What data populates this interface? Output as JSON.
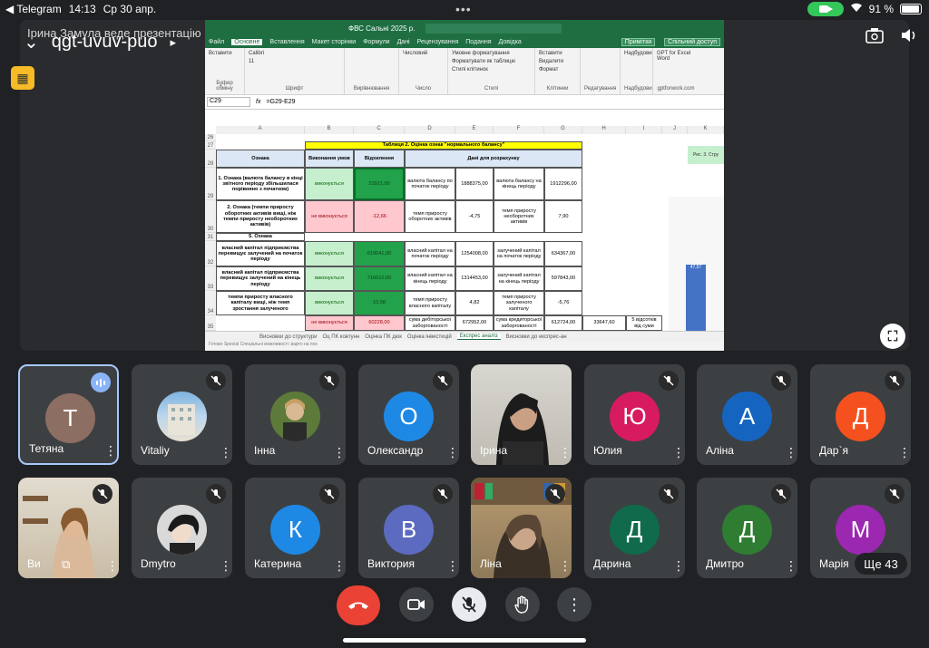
{
  "status_bar": {
    "back_app": "◀ Telegram",
    "time": "14:13",
    "date": "Ср 30 апр.",
    "battery": "91 %"
  },
  "meeting": {
    "code": "qgt-uvuv-puo",
    "overlay_text": "Ірина Замула веде презентацію"
  },
  "excel": {
    "title": "ФВС Сальні 2025 р.",
    "menu": [
      "Файл",
      "Основне",
      "Вставлення",
      "Макет сторінки",
      "Формули",
      "Дані",
      "Рецензування",
      "Подання",
      "Довідка"
    ],
    "menu_right": [
      "Примітки",
      "Спільний доступ"
    ],
    "ribbon_groups": [
      {
        "label": "Буфер обміну",
        "items": [
          "Вставити"
        ]
      },
      {
        "label": "Шрифт",
        "items": [
          "Calibri",
          "11"
        ]
      },
      {
        "label": "Вирівнювання",
        "items": [
          ""
        ]
      },
      {
        "label": "Число",
        "items": [
          "Числовий"
        ]
      },
      {
        "label": "Стилі",
        "items": [
          "Умовне форматування",
          "Форматувати як таблицю",
          "Стилі клітинок"
        ]
      },
      {
        "label": "Клітинки",
        "items": [
          "Вставити",
          "Видалити",
          "Формат"
        ]
      },
      {
        "label": "Редагування",
        "items": [
          ""
        ]
      },
      {
        "label": "Надбудови",
        "items": [
          "Надбудови"
        ]
      },
      {
        "label": "gptforwork.com",
        "items": [
          "GPT for Excel Word"
        ]
      }
    ],
    "namebox": "C29",
    "formula": "=G29-E29",
    "columns": [
      "A",
      "B",
      "C",
      "D",
      "E",
      "F",
      "G",
      "H",
      "I",
      "J",
      "K"
    ],
    "rows": [
      "26",
      "27",
      "28",
      "29",
      "30",
      "31",
      "32",
      "33",
      "34",
      "35"
    ],
    "table_title": "Таблиця 2. Оцінка ознак \"нормального балансу\"",
    "headers": {
      "a": "Ознака",
      "b": "Виконання умов",
      "c": "Відхилення",
      "d": "Дані для розрахунку"
    },
    "r29": {
      "a": "1. Ознака (валюта балансу в кінці звітного періоду збільшилася порівняно з початком)",
      "b": "виконується",
      "c": "23921,00",
      "d": "валюта балансу по початок періоду",
      "e": "1888375,00",
      "f": "валюта балансу на кінець періоду",
      "g": "1912296,00"
    },
    "r30": {
      "a": "2. Ознака (темпи приросту оборотних активів вищі, ніж темпи приросту необоротних активів)",
      "b": "не виконується",
      "c": "-12,66",
      "d": "темп приросту оборотних активів",
      "e": "-4,75",
      "f": "темп приросту необоротних активів",
      "g": "7,90"
    },
    "r31": {
      "a": "5. Ознака"
    },
    "r32": {
      "a": "власний капітал підприємства перевищує залучений на початок періоду",
      "b": "виконується",
      "c": "619641,00",
      "d": "власний капітал на початок періоду",
      "e": "1254008,00",
      "f": "залучений капітал на початок періоду",
      "g": "634367,00"
    },
    "r33": {
      "a": "власний капітал підприємства перевищує залучений на кінець періоду",
      "b": "виконується",
      "c": "716610,00",
      "d": "власний капітал на кінець періоду",
      "e": "1314453,00",
      "f": "залучений капітал на кінець періоду",
      "g": "597843,00"
    },
    "r34": {
      "a": "темпи приросту власного капіталу вищі, ніж темп зростання залученого",
      "b": "виконується",
      "c": "10,58",
      "d": "темп приросту власного капіталу",
      "e": "4,82",
      "f": "темп приросту залученого капіталу",
      "g": "-5,76"
    },
    "r35": {
      "b": "не виконується",
      "c": "60228,00",
      "d": "сума дебіторської заборгованості",
      "e": "672952,00",
      "f": "сума кредиторської заборгованості",
      "g": "612724,00",
      "h": "33647,60",
      "i": "5 відсотків від суми"
    },
    "side_label": "Рис. 3. Стру",
    "side_bar_value": "47,57",
    "sheet_tabs": [
      "Висновки до структури",
      "Оц ПК ковтунн",
      "Оцінка ПК дюк",
      "Оцінка інвестицій",
      "Експрес аналіз",
      "Висновки до експрес-ан"
    ],
    "status": "Готово   Special   Спеціальні можливості: варто на пох"
  },
  "participants": [
    {
      "name": "Тетяна",
      "initial": "Т",
      "color": "#8d6e63",
      "speaking": true
    },
    {
      "name": "Vitaliy",
      "initial": "",
      "color": "#6d8fb5",
      "photo": true
    },
    {
      "name": "Інна",
      "initial": "",
      "color": "#6b7f4a",
      "photo": true
    },
    {
      "name": "Олександр",
      "initial": "О",
      "color": "#1e88e5"
    },
    {
      "name": "Ірина",
      "initial": "",
      "color": "#777",
      "video": true
    },
    {
      "name": "Юлия",
      "initial": "Ю",
      "color": "#d81b60"
    },
    {
      "name": "Аліна",
      "initial": "А",
      "color": "#1565c0"
    },
    {
      "name": "Дар`я",
      "initial": "Д",
      "color": "#f4511e"
    },
    {
      "name": "Ви",
      "initial": "",
      "color": "#a08060",
      "video": true
    },
    {
      "name": "Dmytro",
      "initial": "",
      "color": "#444",
      "photo": true
    },
    {
      "name": "Катерина",
      "initial": "К",
      "color": "#1e88e5"
    },
    {
      "name": "Виктория",
      "initial": "В",
      "color": "#5c6bc0"
    },
    {
      "name": "Ліна",
      "initial": "",
      "color": "#8a7060",
      "video": true
    },
    {
      "name": "Дарина",
      "initial": "Д",
      "color": "#0f6b4b"
    },
    {
      "name": "Дмитро",
      "initial": "Д",
      "color": "#2e7d32"
    },
    {
      "name": "Марія",
      "initial": "М",
      "color": "#9c27b0"
    }
  ],
  "more_participants": "Ще 43"
}
